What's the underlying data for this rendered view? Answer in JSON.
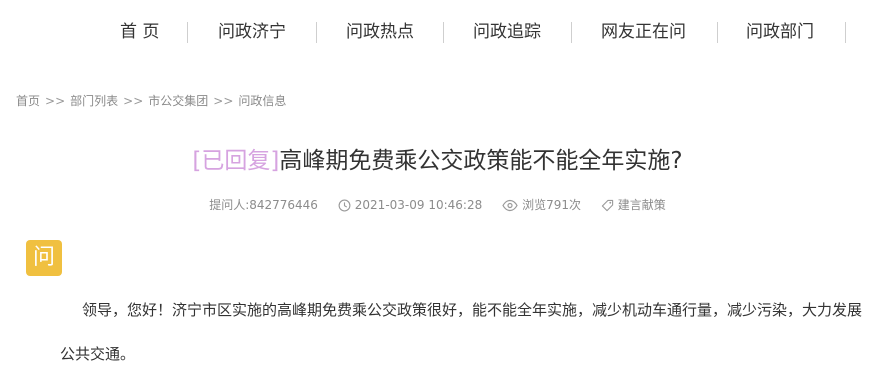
{
  "nav": {
    "items": [
      "首 页",
      "问政济宁",
      "问政热点",
      "问政追踪",
      "网友正在问",
      "问政部门"
    ]
  },
  "breadcrumb": {
    "items": [
      "首页",
      "部门列表",
      "市公交集团",
      "问政信息"
    ],
    "separator": ">>"
  },
  "question": {
    "status": "[已回复]",
    "title": "高峰期免费乘公交政策能不能全年实施?",
    "asker": "提问人:842776446",
    "time": "2021-03-09 10:46:28",
    "views": "浏览791次",
    "category": "建言献策",
    "badge": "问",
    "body": "领导，您好！济宁市区实施的高峰期免费乘公交政策很好，能不能全年实施，减少机动车通行量，减少污染，大力发展公共交通。"
  },
  "colors": {
    "status": "#d6a3e0",
    "badge": "#f0c040"
  },
  "icons": [
    "clock-icon",
    "eye-icon",
    "tag-icon"
  ]
}
